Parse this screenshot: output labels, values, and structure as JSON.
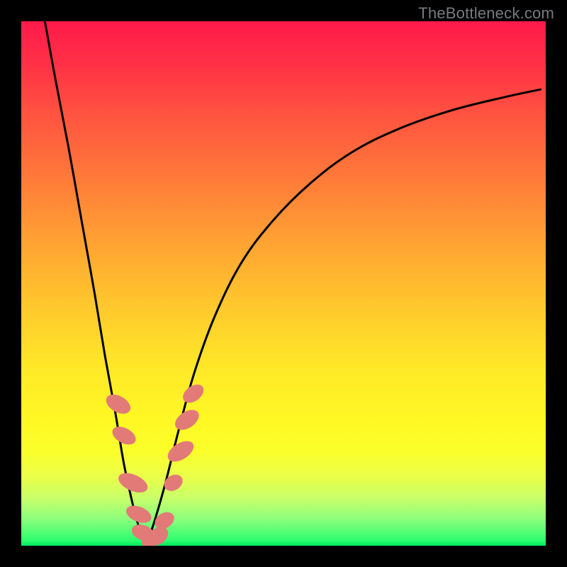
{
  "watermark": "TheBottleneck.com",
  "chart_data": {
    "type": "line",
    "title": "",
    "xlabel": "",
    "ylabel": "",
    "xlim": [
      0,
      100
    ],
    "ylim": [
      0,
      100
    ],
    "grid": false,
    "legend": false,
    "series": [
      {
        "name": "curve-left",
        "x": [
          4.5,
          6.5,
          9.0,
          11.5,
          14.0,
          16.0,
          18.0,
          19.5,
          21.0,
          22.0,
          23.0,
          24.0
        ],
        "y": [
          100,
          89,
          76,
          62,
          48,
          36,
          25,
          16,
          9,
          5,
          2,
          0.5
        ]
      },
      {
        "name": "curve-right",
        "x": [
          24.0,
          25.5,
          27.5,
          30.0,
          33.0,
          37.0,
          42.0,
          48.0,
          55.0,
          63.0,
          72.0,
          82.0,
          92.0,
          99.0
        ],
        "y": [
          0.5,
          5,
          12,
          22,
          33,
          44,
          54,
          62,
          69,
          75,
          79.5,
          83,
          85.5,
          87
        ]
      }
    ],
    "markers": {
      "name": "dots",
      "color": "#e27a78",
      "points": [
        {
          "x": 18.5,
          "y": 27,
          "rx": 2.8,
          "ry": 4.6,
          "rot": -60
        },
        {
          "x": 19.6,
          "y": 21,
          "rx": 2.6,
          "ry": 4.4,
          "rot": -62
        },
        {
          "x": 21.3,
          "y": 12,
          "rx": 2.8,
          "ry": 5.4,
          "rot": -66
        },
        {
          "x": 22.4,
          "y": 6,
          "rx": 2.6,
          "ry": 4.6,
          "rot": -68
        },
        {
          "x": 23.2,
          "y": 2.5,
          "rx": 2.6,
          "ry": 4.0,
          "rot": -70
        },
        {
          "x": 24.4,
          "y": 0.9,
          "rx": 2.6,
          "ry": 3.8,
          "rot": 0
        },
        {
          "x": 26.0,
          "y": 1.8,
          "rx": 2.8,
          "ry": 4.0,
          "rot": 55
        },
        {
          "x": 27.3,
          "y": 4.8,
          "rx": 2.6,
          "ry": 3.6,
          "rot": 58
        },
        {
          "x": 29.0,
          "y": 12,
          "rx": 2.6,
          "ry": 3.4,
          "rot": 58
        },
        {
          "x": 30.4,
          "y": 18,
          "rx": 2.8,
          "ry": 5.0,
          "rot": 58
        },
        {
          "x": 31.6,
          "y": 24,
          "rx": 2.8,
          "ry": 4.6,
          "rot": 56
        },
        {
          "x": 32.8,
          "y": 29,
          "rx": 2.6,
          "ry": 4.0,
          "rot": 54
        }
      ]
    },
    "gradient_stops": [
      {
        "pos": 0,
        "color": "#ff1a4a"
      },
      {
        "pos": 40,
        "color": "#ffa233"
      },
      {
        "pos": 70,
        "color": "#fff824"
      },
      {
        "pos": 100,
        "color": "#00e85e"
      }
    ]
  }
}
